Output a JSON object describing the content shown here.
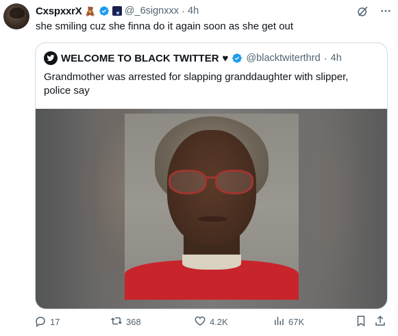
{
  "tweet": {
    "display_name": "CxspxxrX",
    "badge_emoji": "🧸",
    "handle": "@_6signxxx",
    "separator": "·",
    "time": "4h",
    "text": "she smiling cuz she finna do it again soon as she get out"
  },
  "quote": {
    "display_name": "WELCOME TO BLACK TWITTER",
    "heart_emoji": "♥",
    "handle": "@blacktwiterthrd",
    "separator": "·",
    "time": "4h",
    "text": "Grandmother was arrested for slapping granddaughter with slipper, police say"
  },
  "actions": {
    "replies": "17",
    "reposts": "368",
    "likes": "4.2K",
    "views": "67K"
  },
  "icons": {
    "verified": "verified-badge-icon",
    "grok": "grok-icon",
    "more": "more-icon",
    "reply": "reply-icon",
    "repost": "repost-icon",
    "like": "like-icon",
    "views": "views-icon",
    "bookmark": "bookmark-icon",
    "share": "share-icon"
  },
  "colors": {
    "verified_blue": "#1d9bf0",
    "text_primary": "#0f1419",
    "text_secondary": "#536471",
    "border": "#cfd9de",
    "shirt_red": "#c8242b"
  }
}
